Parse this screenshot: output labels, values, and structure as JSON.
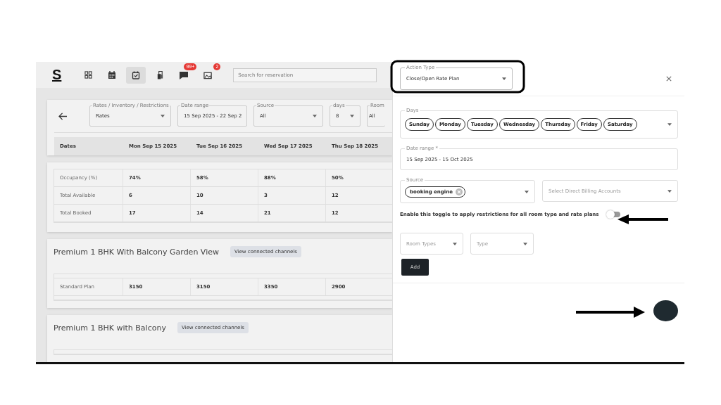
{
  "app_bar": {
    "logo": "S",
    "nav": [
      {
        "kind": "grid",
        "selected": false
      },
      {
        "kind": "calendar",
        "selected": false
      },
      {
        "kind": "check",
        "selected": true
      },
      {
        "kind": "luggage",
        "selected": false
      },
      {
        "kind": "chat",
        "selected": false,
        "badge": "99+"
      },
      {
        "kind": "image",
        "selected": false,
        "badge": "2"
      }
    ],
    "search": {
      "placeholder": "Search for reservation"
    }
  },
  "filters": [
    {
      "label": "Rates / Inventory / Restrictions",
      "value": "Rates",
      "dropdown": true
    },
    {
      "label": "Date range",
      "value": "15 Sep 2025 - 22 Sep 2",
      "dropdown": false
    },
    {
      "label": "Source",
      "value": "All",
      "dropdown": true
    },
    {
      "label": "days",
      "value": "8",
      "dropdown": true
    },
    {
      "label": "Room",
      "value": "All",
      "dropdown": false
    }
  ],
  "columns": [
    "Dates",
    "Mon Sep 15 2025",
    "Tue Sep 16 2025",
    "Wed Sep 17 2025",
    "Thu Sep 18 2025"
  ],
  "summary_rows": [
    {
      "label": "Occupancy (%)",
      "values": [
        "74%",
        "58%",
        "88%",
        "50%"
      ]
    },
    {
      "label": "Total Available",
      "values": [
        "6",
        "10",
        "3",
        "12"
      ]
    },
    {
      "label": "Total Booked",
      "values": [
        "17",
        "14",
        "21",
        "12"
      ]
    }
  ],
  "rooms": [
    {
      "name": "Premium 1 BHK With Balcony Garden View",
      "button": "View connected channels",
      "rows": [
        {
          "label": "Standard Plan",
          "values": [
            "3150",
            "3150",
            "3350",
            "2900"
          ]
        }
      ]
    },
    {
      "name": "Premium 1 BHK with Balcony",
      "button": "View connected channels"
    }
  ],
  "drawer": {
    "action_type": {
      "label": "Action Type",
      "value": "Close/Open Rate Plan"
    },
    "days": {
      "label": "Days",
      "chips": [
        "Sunday",
        "Monday",
        "Tuesday",
        "Wednesday",
        "Thursday",
        "Friday",
        "Saturday"
      ]
    },
    "date_range": {
      "label": "Date range *",
      "value": "15 Sep 2025 - 15 Oct 2025"
    },
    "source": {
      "label": "Source",
      "chips": [
        "booking engine"
      ]
    },
    "billing": {
      "placeholder": "Select Direct Billing Accounts"
    },
    "toggle": {
      "label": "Enable this toggle to apply restrictions for all room type and rate plans",
      "on": false
    },
    "room_types": {
      "placeholder": "Room Types"
    },
    "type": {
      "placeholder": "Type"
    },
    "add_button": "Add"
  }
}
